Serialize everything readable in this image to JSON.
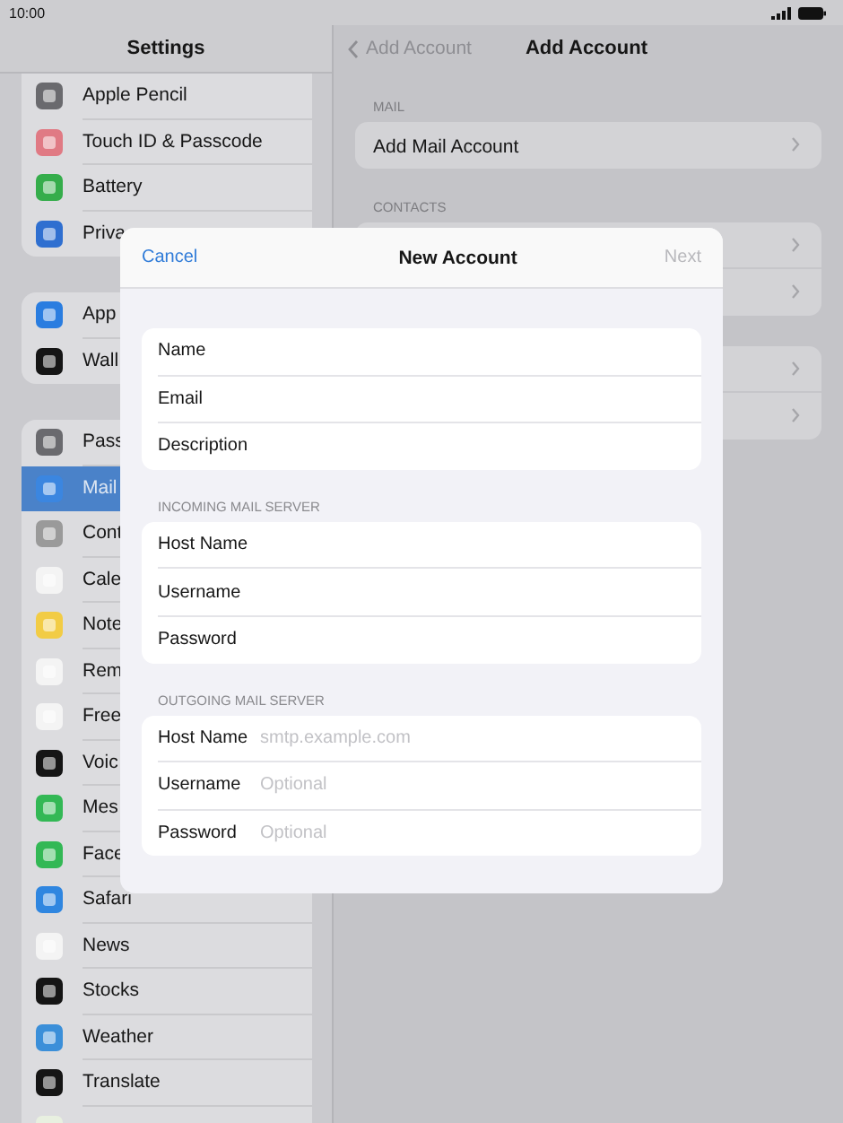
{
  "status_bar": {
    "time": "10:00"
  },
  "sidebar": {
    "title": "Settings",
    "groups": [
      {
        "items": [
          {
            "label": "Apple Pencil",
            "color": "#6a6a6e",
            "selected": false
          },
          {
            "label": "Touch ID & Passcode",
            "color": "#e07a84",
            "selected": false
          },
          {
            "label": "Battery",
            "color": "#35ad4b",
            "selected": false
          },
          {
            "label": "Priva",
            "color": "#2f6fd0",
            "selected": false
          }
        ]
      },
      {
        "items": [
          {
            "label": "App",
            "color": "#2a7de0",
            "selected": false
          },
          {
            "label": "Wall",
            "color": "#151515",
            "selected": false
          }
        ]
      },
      {
        "items": [
          {
            "label": "Pass",
            "color": "#6a6a6e",
            "selected": false
          },
          {
            "label": "Mail",
            "color": "#3b86e0",
            "selected": true
          },
          {
            "label": "Cont",
            "color": "#9a9a9a",
            "selected": false
          },
          {
            "label": "Cale",
            "color": "#f4f4f4",
            "selected": false
          },
          {
            "label": "Note",
            "color": "#f2cc45",
            "selected": false
          },
          {
            "label": "Rem",
            "color": "#f4f4f4",
            "selected": false
          },
          {
            "label": "Free",
            "color": "#f4f4f4",
            "selected": false
          },
          {
            "label": "Voic",
            "color": "#151515",
            "selected": false
          },
          {
            "label": "Mes",
            "color": "#33b855",
            "selected": false
          },
          {
            "label": "Face",
            "color": "#33b855",
            "selected": false
          },
          {
            "label": "Safari",
            "color": "#2f86e0",
            "selected": false
          },
          {
            "label": "News",
            "color": "#f4f4f4",
            "selected": false
          },
          {
            "label": "Stocks",
            "color": "#151515",
            "selected": false
          },
          {
            "label": "Weather",
            "color": "#3b8fd9",
            "selected": false
          },
          {
            "label": "Translate",
            "color": "#151515",
            "selected": false
          },
          {
            "color": "#e8f0e0",
            "selected": false
          }
        ]
      }
    ]
  },
  "detail": {
    "back": "Add Account",
    "title": "Add Account",
    "sections": [
      {
        "header": "MAIL",
        "rows": [
          {
            "label": "Add Mail Account",
            "kind": "link"
          }
        ]
      },
      {
        "header": "CONTACTS",
        "rows": [
          {
            "kind": "link"
          },
          {
            "kind": "link"
          }
        ]
      },
      {
        "rows": [
          {
            "kind": "link"
          },
          {
            "kind": "link"
          }
        ]
      }
    ]
  },
  "modal": {
    "cancel": "Cancel",
    "title": "New Account",
    "next": "Next",
    "next_disabled": true,
    "sections": [
      {
        "fields": [
          {
            "label": "Name"
          },
          {
            "label": "Email"
          },
          {
            "label": "Description"
          }
        ]
      },
      {
        "header": "INCOMING MAIL SERVER",
        "fields": [
          {
            "label": "Host Name"
          },
          {
            "label": "Username"
          },
          {
            "label": "Password"
          }
        ]
      },
      {
        "header": "OUTGOING MAIL SERVER",
        "fields": [
          {
            "label": "Host Name",
            "placeholder": "smtp.example.com"
          },
          {
            "label": "Username",
            "placeholder": "Optional"
          },
          {
            "label": "Password",
            "placeholder": "Optional"
          }
        ]
      }
    ]
  }
}
